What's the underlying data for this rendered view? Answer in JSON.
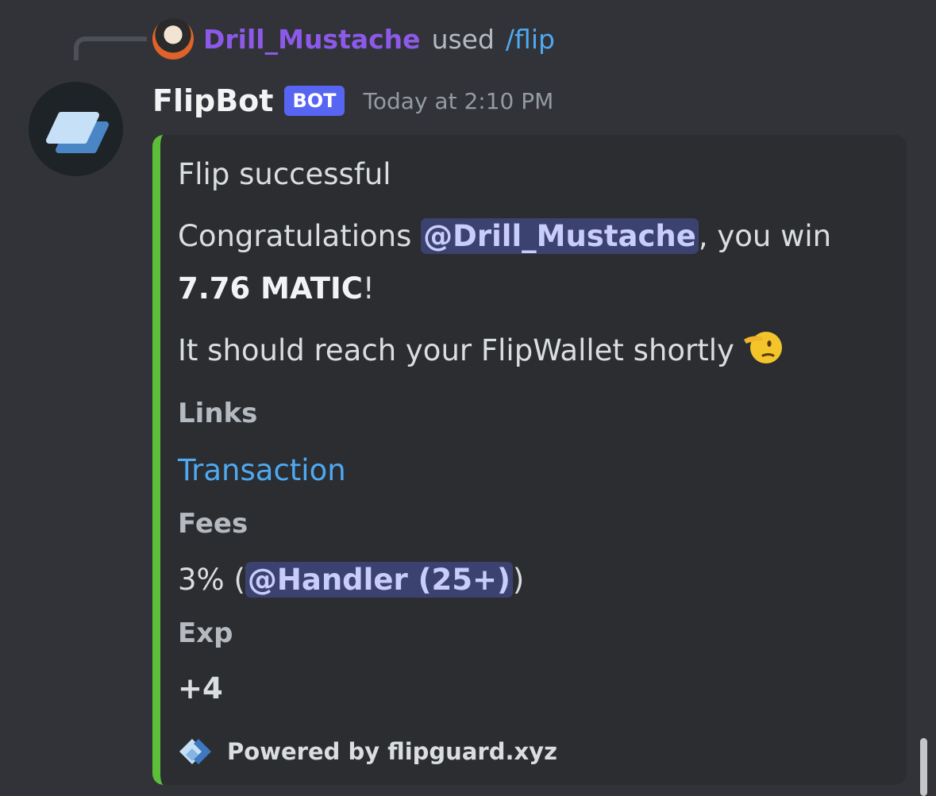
{
  "reply": {
    "username": "Drill_Mustache",
    "used_text": "used",
    "command": "/flip"
  },
  "message": {
    "author": "FlipBot",
    "bot_tag": "BOT",
    "timestamp": "Today at 2:10 PM"
  },
  "embed": {
    "accent_color": "#5bbf3a",
    "title": "Flip successful",
    "description": {
      "congrats_prefix": "Congratulations ",
      "mention": "@Drill_Mustache",
      "congrats_suffix": ", you win",
      "amount": "7.76 MATIC",
      "amount_suffix": "!",
      "wallet_line": "It should reach your FlipWallet shortly",
      "emoji": "saluting-face"
    },
    "fields": {
      "links": {
        "name": "Links",
        "value": "Transaction"
      },
      "fees": {
        "name": "Fees",
        "value_prefix": "3% (",
        "mention": "@Handler (25+)",
        "value_suffix": ")"
      },
      "exp": {
        "name": "Exp",
        "value": "+4"
      }
    },
    "footer": {
      "icon": "flipguard-logo",
      "text": "Powered by flipguard.xyz"
    }
  },
  "colors": {
    "background": "#313338",
    "embed_background": "#2b2d31",
    "username": "#8c59e8",
    "link": "#4fa9f1",
    "bot_tag": "#5865f2",
    "mention_bg": "#3c4270"
  }
}
